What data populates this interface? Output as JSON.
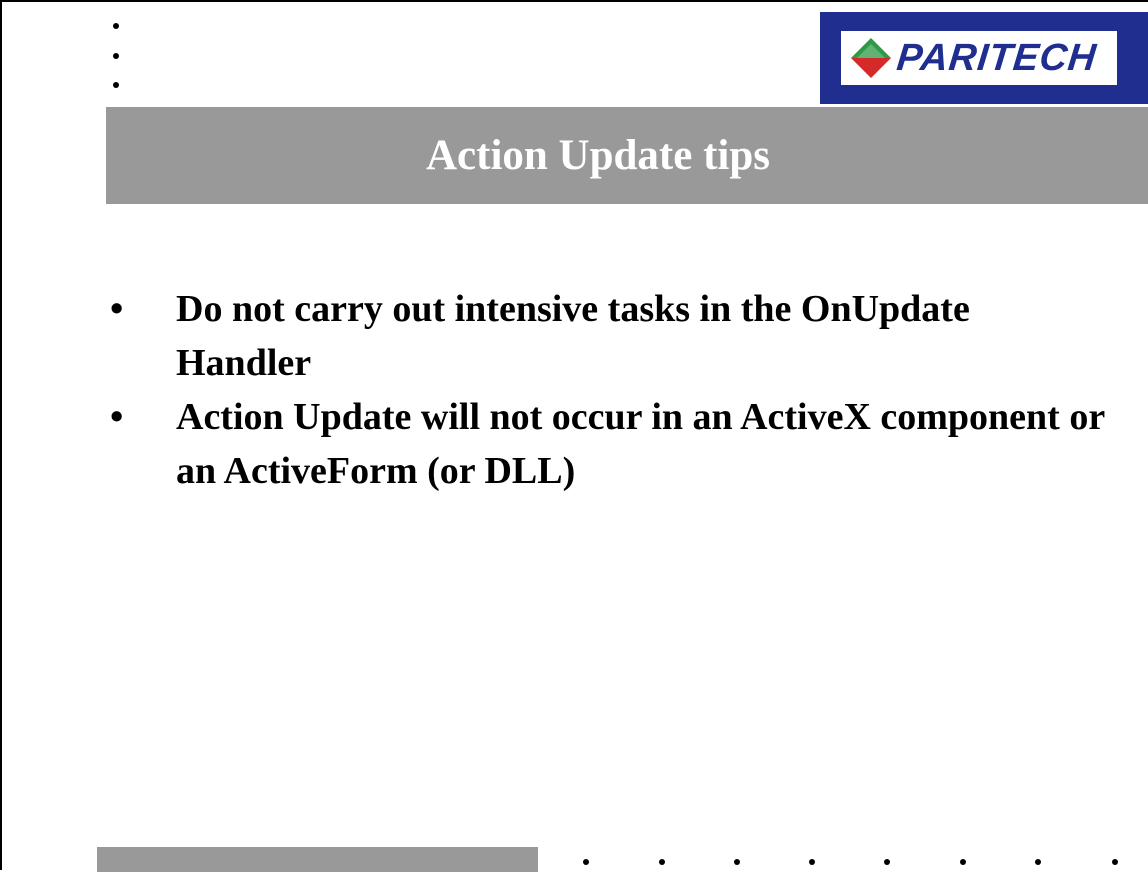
{
  "logo": {
    "text": "PARITECH"
  },
  "slide": {
    "title": "Action Update tips",
    "bullet_marker": "•",
    "bullets": [
      {
        "text": "Do not carry out intensive tasks in the OnUpdate Handler"
      },
      {
        "text": "Action Update will not occur in an ActiveX component or an ActiveForm (or DLL)"
      }
    ]
  },
  "colors": {
    "title_bar": "#999999",
    "logo_background": "#1f2e8f",
    "title_text": "#ffffff",
    "logo_red": "#d62a2a",
    "logo_green": "#2e9a45"
  }
}
